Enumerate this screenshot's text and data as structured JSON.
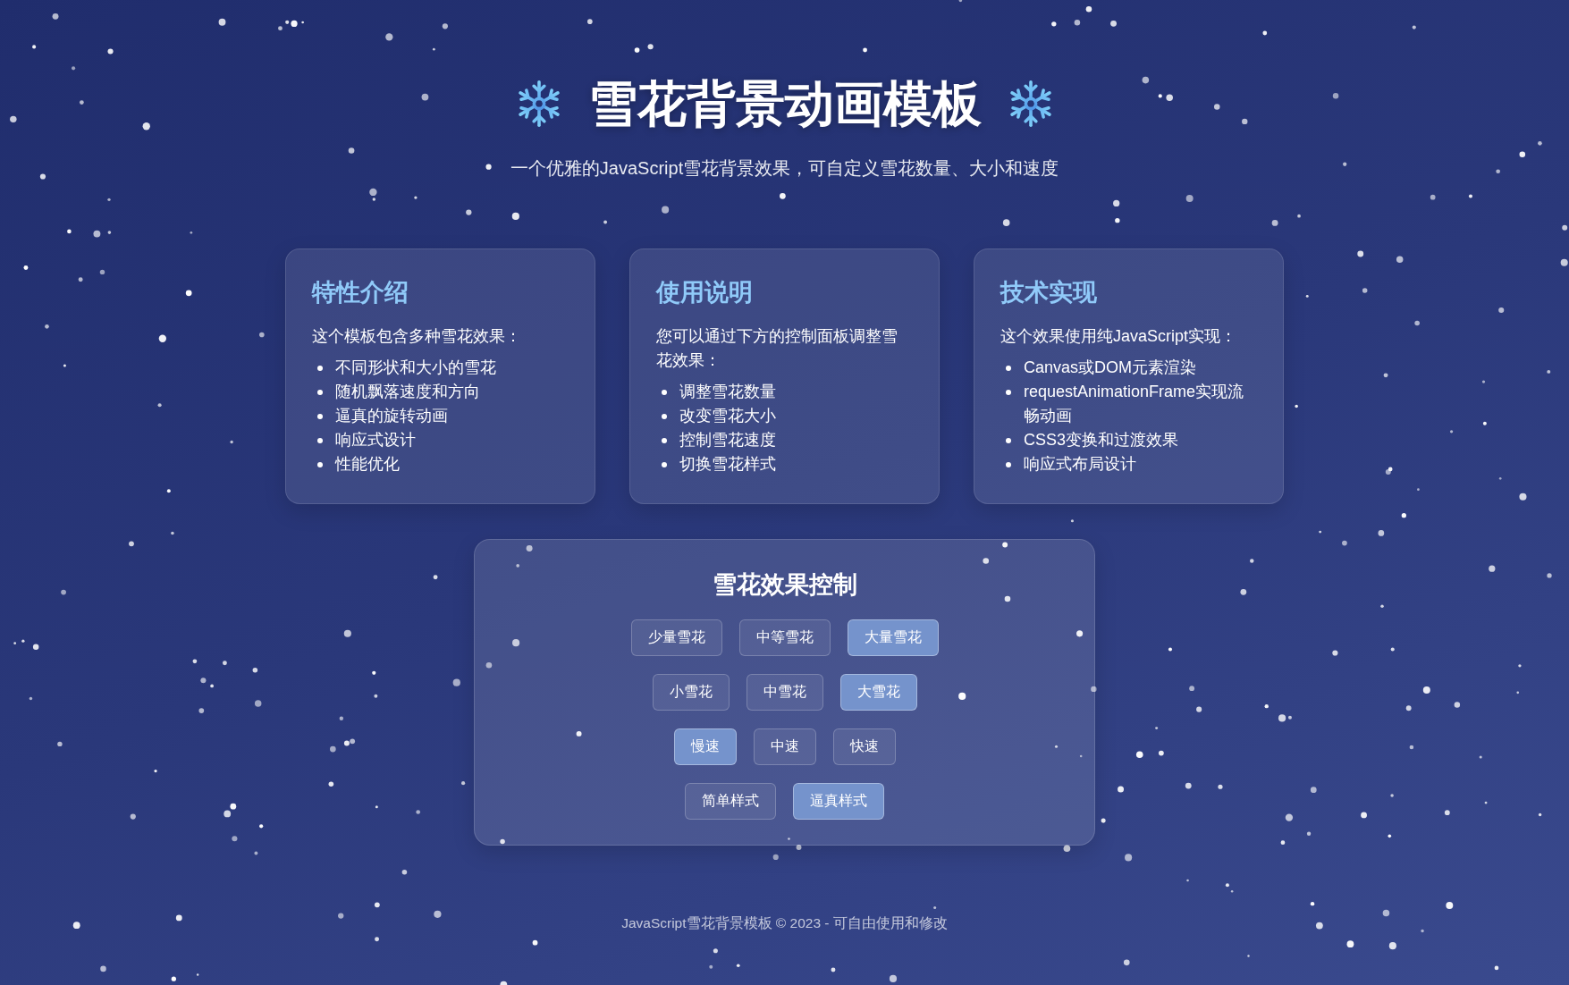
{
  "header": {
    "title": "雪花背景动画模板",
    "subtitle": "一个优雅的JavaScript雪花背景效果，可自定义雪花数量、大小和速度"
  },
  "cards": [
    {
      "title": "特性介绍",
      "intro": "这个模板包含多种雪花效果：",
      "items": [
        "不同形状和大小的雪花",
        "随机飘落速度和方向",
        "逼真的旋转动画",
        "响应式设计",
        "性能优化"
      ]
    },
    {
      "title": "使用说明",
      "intro": "您可以通过下方的控制面板调整雪花效果：",
      "items": [
        "调整雪花数量",
        "改变雪花大小",
        "控制雪花速度",
        "切换雪花样式"
      ]
    },
    {
      "title": "技术实现",
      "intro": "这个效果使用纯JavaScript实现：",
      "items": [
        "Canvas或DOM元素渲染",
        "requestAnimationFrame实现流畅动画",
        "CSS3变换和过渡效果",
        "响应式布局设计"
      ]
    }
  ],
  "control_panel": {
    "title": "雪花效果控制",
    "groups": [
      {
        "buttons": [
          {
            "label": "少量雪花",
            "selected": false
          },
          {
            "label": "中等雪花",
            "selected": false
          },
          {
            "label": "大量雪花",
            "selected": true
          }
        ]
      },
      {
        "buttons": [
          {
            "label": "小雪花",
            "selected": false
          },
          {
            "label": "中雪花",
            "selected": false
          },
          {
            "label": "大雪花",
            "selected": true
          }
        ]
      },
      {
        "buttons": [
          {
            "label": "慢速",
            "selected": true
          },
          {
            "label": "中速",
            "selected": false
          },
          {
            "label": "快速",
            "selected": false
          }
        ]
      },
      {
        "buttons": [
          {
            "label": "简单样式",
            "selected": false
          },
          {
            "label": "逼真样式",
            "selected": true
          }
        ]
      }
    ]
  },
  "footer": "JavaScript雪花背景模板 © 2023 - 可自由使用和修改"
}
